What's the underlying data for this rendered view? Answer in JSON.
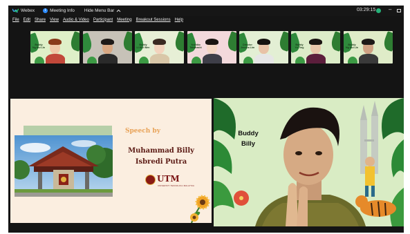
{
  "titlebar": {
    "app_name": "Webex",
    "meeting_info": "Meeting Info",
    "hide_menu": "Hide Menu Bar",
    "hide_menu_icon": "chevron-up-icon",
    "clock": "03:29:15",
    "status_color": "#26b37a",
    "accent": "#2d8cff"
  },
  "menu": [
    "File",
    "Edit",
    "Share",
    "View",
    "Audio & Video",
    "Participant",
    "Meeting",
    "Breakout Sessions",
    "Help"
  ],
  "participants": [
    {
      "name": "Buddy\nNg Hui Lin",
      "skin": "#f0c8a8",
      "hair": "#8a3a1a",
      "shirt": "#c2483a",
      "bg": "#dff0c8"
    },
    {
      "name": "",
      "skin": "#d9a883",
      "hair": "#1e1a18",
      "shirt": "#2a2a2a",
      "bg": "#c7c2b8"
    },
    {
      "name": "Buddy\nLi Wei Wen",
      "skin": "#f3d3bd",
      "hair": "#3a2a22",
      "shirt": "#d9c7a8",
      "bg": "#e7efd6"
    },
    {
      "name": "Yoshiko\nTakahashi",
      "skin": "#f4d7c4",
      "hair": "#1a1512",
      "shirt": "#3e3e48",
      "bg": "#f3d9dc"
    },
    {
      "name": "Director\nJessica Lim",
      "skin": "#e8c2a6",
      "hair": "#16120f",
      "shirt": "#e6e6e6",
      "bg": "#e3efd4"
    },
    {
      "name": "Buddy\nYu Ting",
      "skin": "#e9c6aa",
      "hair": "#1b1512",
      "shirt": "#5c1e3c",
      "bg": "#dcecc8"
    },
    {
      "name": "Buddy\nNg Hui Lin",
      "skin": "#cfa183",
      "hair": "#1d1917",
      "shirt": "#3a3a3a",
      "bg": "#dfecc8"
    }
  ],
  "slide": {
    "speech_by": "Speech by",
    "speaker_line1": "Muhammad Billy",
    "speaker_line2": "Isbredi Putra",
    "logo_text": "UTM",
    "logo_subtitle": "UNIVERSITI TEKNOLOGI MALAYSIA"
  },
  "speaker": {
    "label": "Buddy\nBilly"
  }
}
